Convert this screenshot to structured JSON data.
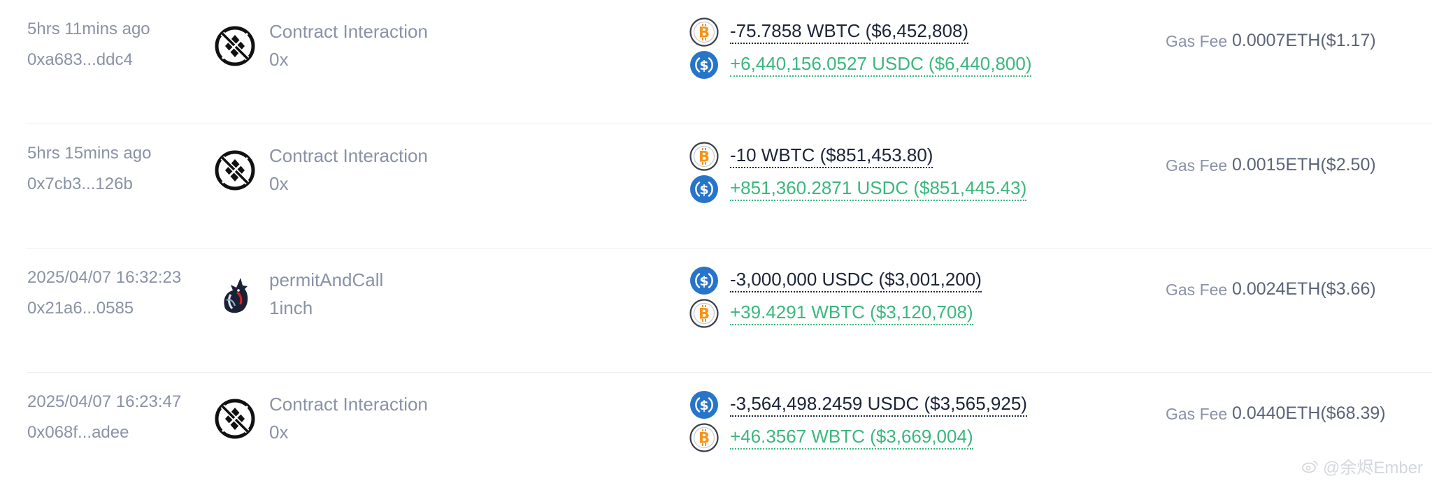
{
  "transactions": [
    {
      "time": "5hrs 11mins ago",
      "hash": "0xa683...ddc4",
      "method_icon": "blocked-circle-icon",
      "method": "Contract Interaction",
      "target": "0x",
      "transfers": [
        {
          "direction": "out",
          "token_icon": "wbtc-icon",
          "amount": "-75.7858 WBTC ($6,452,808)"
        },
        {
          "direction": "in",
          "token_icon": "usdc-icon",
          "amount": "+6,440,156.0527 USDC ($6,440,800)"
        }
      ],
      "gas_label": "Gas Fee",
      "gas_value": "0.0007ETH($1.17)"
    },
    {
      "time": "5hrs 15mins ago",
      "hash": "0x7cb3...126b",
      "method_icon": "blocked-circle-icon",
      "method": "Contract Interaction",
      "target": "0x",
      "transfers": [
        {
          "direction": "out",
          "token_icon": "wbtc-icon",
          "amount": "-10 WBTC ($851,453.80)"
        },
        {
          "direction": "in",
          "token_icon": "usdc-icon",
          "amount": "+851,360.2871 USDC ($851,445.43)"
        }
      ],
      "gas_label": "Gas Fee",
      "gas_value": "0.0015ETH($2.50)"
    },
    {
      "time": "2025/04/07 16:32:23",
      "hash": "0x21a6...0585",
      "method_icon": "unicorn-1inch-icon",
      "method": "permitAndCall",
      "target": "1inch",
      "transfers": [
        {
          "direction": "out",
          "token_icon": "usdc-icon",
          "amount": "-3,000,000 USDC ($3,001,200)"
        },
        {
          "direction": "in",
          "token_icon": "wbtc-icon",
          "amount": "+39.4291 WBTC ($3,120,708)"
        }
      ],
      "gas_label": "Gas Fee",
      "gas_value": "0.0024ETH($3.66)"
    },
    {
      "time": "2025/04/07 16:23:47",
      "hash": "0x068f...adee",
      "method_icon": "blocked-circle-icon",
      "method": "Contract Interaction",
      "target": "0x",
      "transfers": [
        {
          "direction": "out",
          "token_icon": "usdc-icon",
          "amount": "-3,564,498.2459 USDC ($3,565,925)"
        },
        {
          "direction": "in",
          "token_icon": "wbtc-icon",
          "amount": "+46.3567 WBTC ($3,669,004)"
        }
      ],
      "gas_label": "Gas Fee",
      "gas_value": "0.0440ETH($68.39)"
    }
  ],
  "watermark": "@余烬Ember",
  "colors": {
    "out_text": "#1c2438",
    "in_text": "#3bb77e",
    "muted_text": "#8a92a6",
    "usdc": "#2775ca",
    "btc": "#f7931a"
  }
}
